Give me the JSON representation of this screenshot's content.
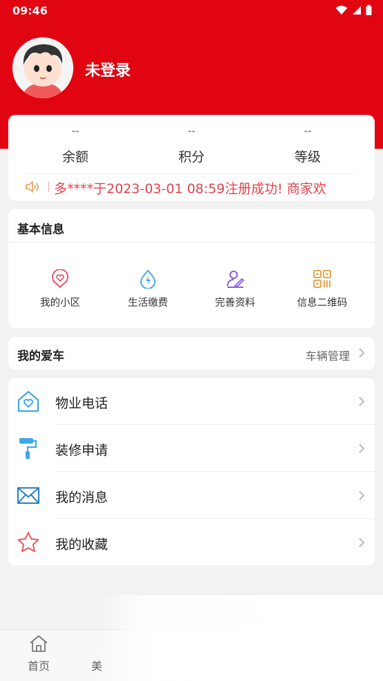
{
  "status_bar": {
    "time": "09:46"
  },
  "profile": {
    "username": "未登录"
  },
  "stats": [
    {
      "value": "--",
      "label": "余额"
    },
    {
      "value": "--",
      "label": "积分"
    },
    {
      "value": "--",
      "label": "等级"
    }
  ],
  "notice": {
    "text": "多****于2023-03-01 08:59注册成功!    商家欢"
  },
  "basic_info": {
    "title": "基本信息",
    "items": [
      {
        "label": "我的小区",
        "icon": "heart-pin-icon",
        "color": "#e8576a"
      },
      {
        "label": "生活缴费",
        "icon": "water-drop-icon",
        "color": "#3fa9e6"
      },
      {
        "label": "完善资料",
        "icon": "edit-profile-icon",
        "color": "#8a5be0"
      },
      {
        "label": "信息二维码",
        "icon": "qr-code-icon",
        "color": "#e6a64a"
      }
    ]
  },
  "car": {
    "title": "我的爱车",
    "manage_label": "车辆管理"
  },
  "menu": [
    {
      "label": "物业电话",
      "icon": "house-heart-icon",
      "color": "#3fa9e6"
    },
    {
      "label": "装修申请",
      "icon": "paint-roller-icon",
      "color": "#3fa9e6"
    },
    {
      "label": "我的消息",
      "icon": "envelope-icon",
      "color": "#2a7fc1"
    },
    {
      "label": "我的收藏",
      "icon": "star-icon",
      "color": "#e85a5a"
    }
  ],
  "tabbar": [
    {
      "label": "首页",
      "icon": "home-icon"
    },
    {
      "label": "美"
    }
  ],
  "colors": {
    "brand_red": "#e10511",
    "notice_red": "#e0444e",
    "page_bg": "#f2f2f2"
  }
}
